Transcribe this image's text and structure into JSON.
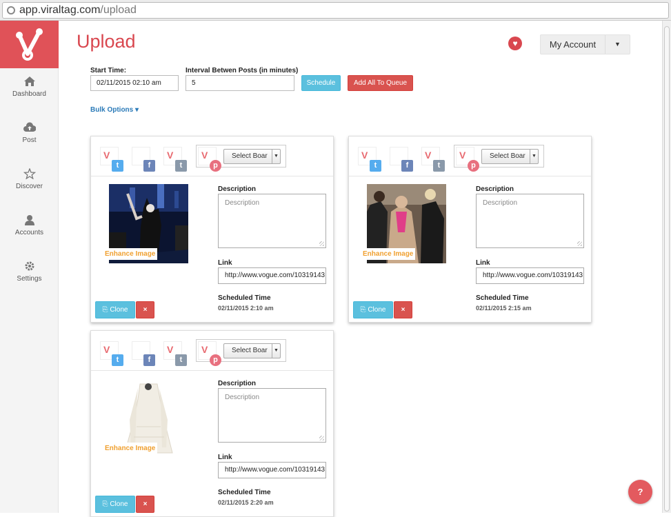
{
  "browser": {
    "url_host": "app.viraltag.com",
    "url_path": "/upload"
  },
  "sidebar": {
    "items": [
      {
        "label": "Dashboard",
        "icon": "home-icon"
      },
      {
        "label": "Post",
        "icon": "cloud-upload-icon"
      },
      {
        "label": "Discover",
        "icon": "star-icon"
      },
      {
        "label": "Accounts",
        "icon": "user-icon"
      },
      {
        "label": "Settings",
        "icon": "gear-icon"
      }
    ]
  },
  "header": {
    "title": "Upload",
    "account_label": "My Account"
  },
  "form": {
    "start_time_label": "Start Time:",
    "start_time_value": "02/11/2015 02:10 am",
    "interval_label": "Interval Betwen Posts (in minutes)",
    "interval_value": "5",
    "schedule_button": "Schedule",
    "queue_button": "Add All To Queue",
    "bulk_options": "Bulk Options ▾"
  },
  "cards": [
    {
      "select_board": "Select Boar",
      "enhance": "Enhance Image",
      "description_label": "Description",
      "description_placeholder": "Description",
      "link_label": "Link",
      "link_value": "http://www.vogue.com/10319143",
      "scheduled_label": "Scheduled Time",
      "scheduled_value": "02/11/2015 2:10 am",
      "clone": "Clone",
      "delete": "×"
    },
    {
      "select_board": "Select Boar",
      "enhance": "Enhance Image",
      "description_label": "Description",
      "description_placeholder": "Description",
      "link_label": "Link",
      "link_value": "http://www.vogue.com/10319143",
      "scheduled_label": "Scheduled Time",
      "scheduled_value": "02/11/2015 2:15 am",
      "clone": "Clone",
      "delete": "×"
    },
    {
      "select_board": "Select Boar",
      "enhance": "Enhance Image",
      "description_label": "Description",
      "description_placeholder": "Description",
      "link_label": "Link",
      "link_value": "http://www.vogue.com/10319143",
      "scheduled_label": "Scheduled Time",
      "scheduled_value": "02/11/2015 2:20 am",
      "clone": "Clone",
      "delete": "×"
    }
  ],
  "network_badges": {
    "twitter": "t",
    "facebook": "f",
    "tumblr": "t",
    "pinterest": "p"
  },
  "colors": {
    "brand": "#e05258",
    "title": "#d9474f",
    "info": "#5bc0de",
    "danger": "#d9534f",
    "link": "#2a7ab8",
    "enhance": "#f0a030"
  }
}
